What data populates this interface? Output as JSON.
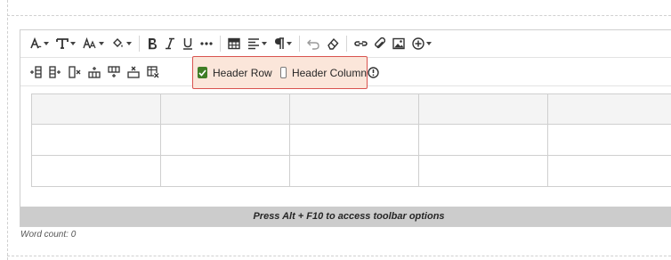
{
  "table_options": {
    "header_row": {
      "label": "Header Row",
      "checked": true
    },
    "header_column": {
      "label": "Header Column",
      "checked": false
    }
  },
  "status_bar": {
    "text": "Press Alt + F10 to access toolbar options"
  },
  "word_count": {
    "label": "Word count: 0"
  },
  "toolbar_icons": [
    "font-family-icon",
    "font-size-icon",
    "text-style-icon",
    "highlight-icon",
    "bold-icon",
    "italic-icon",
    "underline-icon",
    "more-icon",
    "table-icon",
    "align-icon",
    "paragraph-icon",
    "undo-icon",
    "eraser-icon",
    "link-icon",
    "attach-icon",
    "image-icon",
    "add-content-icon"
  ],
  "table_toolbar_icons": [
    "insert-column-before-icon",
    "insert-column-after-icon",
    "delete-column-icon",
    "insert-row-above-icon",
    "insert-row-below-icon",
    "delete-row-icon",
    "delete-table-icon",
    "table-info-icon"
  ],
  "table": {
    "rows": 3,
    "columns": 5,
    "cells": [
      [
        "",
        "",
        "",
        "",
        ""
      ],
      [
        "",
        "",
        "",
        "",
        ""
      ],
      [
        "",
        "",
        "",
        "",
        ""
      ]
    ]
  },
  "colors": {
    "accent_checked": "#3f7e26",
    "highlight_bg": "#fbe6da",
    "highlight_border": "#d9534f",
    "status_bg": "#cccccc"
  }
}
